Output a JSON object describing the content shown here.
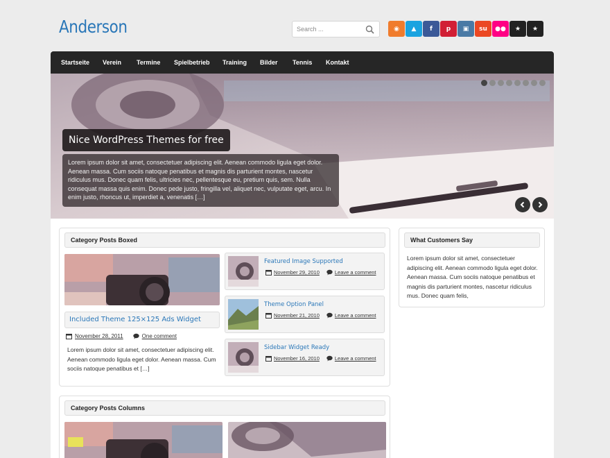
{
  "site": {
    "title": "Anderson"
  },
  "search": {
    "placeholder": "Search ..."
  },
  "social": [
    {
      "icon": "rss-icon",
      "glyph": "◉",
      "color": "#f07c2d"
    },
    {
      "icon": "twitter-icon",
      "glyph": "▲",
      "color": "#1aa3e0"
    },
    {
      "icon": "facebook-icon",
      "glyph": "f",
      "color": "#3b5998"
    },
    {
      "icon": "pinterest-icon",
      "glyph": "p",
      "color": "#d11f35"
    },
    {
      "icon": "instagram-icon",
      "glyph": "▣",
      "color": "#4a7aa5"
    },
    {
      "icon": "stumbleupon-icon",
      "glyph": "su",
      "color": "#eb4823"
    },
    {
      "icon": "flickr-icon",
      "glyph": "●●",
      "color": "#ff0084"
    },
    {
      "icon": "star-icon",
      "glyph": "★",
      "color": "#222222"
    },
    {
      "icon": "star-icon",
      "glyph": "★",
      "color": "#222222"
    }
  ],
  "nav": {
    "items": [
      "Startseite",
      "Verein",
      "Termine",
      "Spielbetrieb",
      "Training",
      "Bilder",
      "Tennis",
      "Kontakt"
    ]
  },
  "slider": {
    "title": "Nice WordPress Themes for free",
    "excerpt": "Lorem ipsum dolor sit amet, consectetuer adipiscing elit. Aenean commodo ligula eget dolor. Aenean massa. Cum sociis natoque penatibus et magnis dis parturient montes, nascetur ridiculus mus. Donec quam felis, ultricies nec, pellentesque eu, pretium quis, sem. Nulla consequat massa quis enim. Donec pede justo, fringilla vel, aliquet nec, vulputate eget, arcu. In enim justo, rhoncus ut, imperdiet a, venenatis […]",
    "dot_count": 8,
    "active_dot": 1
  },
  "boxed": {
    "title": "Category Posts Boxed",
    "main": {
      "title": "Included Theme 125×125 Ads Widget",
      "date": "November 28, 2011",
      "comments": "One comment",
      "excerpt": "Lorem ipsum dolor sit amet, consectetuer adipiscing elit. Aenean commodo ligula eget dolor. Aenean massa. Cum sociis natoque penatibus et […]"
    },
    "items": [
      {
        "title": "Featured Image Supported",
        "date": "November 29, 2010",
        "comments": "Leave a comment"
      },
      {
        "title": "Theme Option Panel",
        "date": "November 21, 2010",
        "comments": "Leave a comment"
      },
      {
        "title": "Sidebar Widget Ready",
        "date": "November 16, 2010",
        "comments": "Leave a comment"
      }
    ]
  },
  "columns": {
    "title": "Category Posts Columns"
  },
  "sidebar": {
    "title": "What Customers Say",
    "text": "Lorem ipsum dolor sit amet, consectetuer adipiscing elit. Aenean commodo ligula eget dolor. Aenean massa. Cum sociis natoque penatibus et magnis dis parturient montes, nascetur ridiculus mus. Donec quam felis,"
  }
}
